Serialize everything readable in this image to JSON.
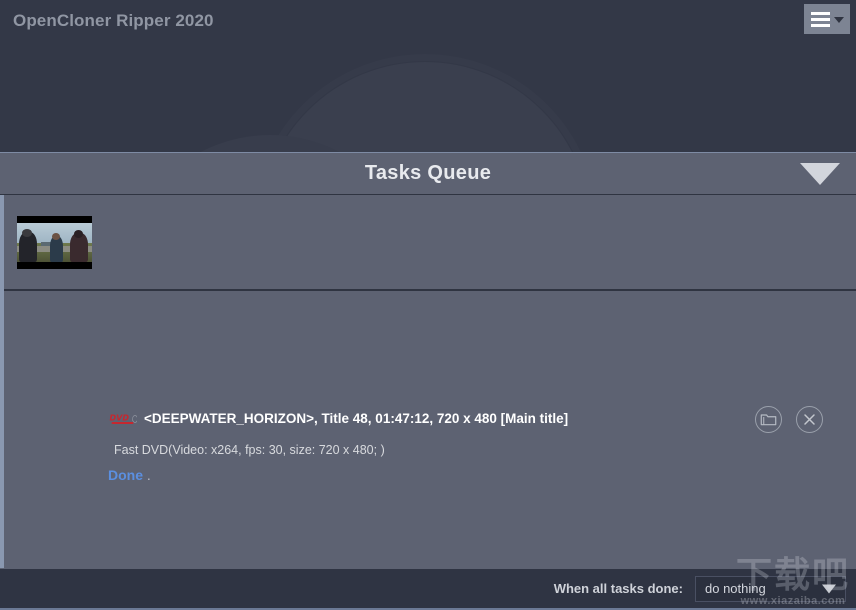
{
  "window": {
    "app_title": "OpenCloner Ripper 2020"
  },
  "header": {
    "menu_button_icon": "hamburger-menu-icon",
    "menu_caret_icon": "chevron-down-icon"
  },
  "queue": {
    "title": "Tasks Queue",
    "collapse_icon": "triangle-down-icon"
  },
  "tasks": [
    {
      "media_icon": "dvd-icon",
      "title": "<DEEPWATER_HORIZON>, Title 48, 01:47:12, 720 x 480 [Main title]",
      "subtitle": "Fast DVD(Video: x264, fps: 30, size: 720 x 480; )",
      "status": "Done",
      "status_suffix": ".",
      "status_color": "#5b8fe0",
      "open_folder_icon": "folder-icon",
      "remove_icon": "close-circle-icon",
      "thumbnail_icon": "video-thumbnail"
    }
  ],
  "footer": {
    "when_done_label": "When all tasks done:",
    "when_done_value": "do nothing",
    "when_done_caret_icon": "triangle-down-icon"
  },
  "watermark": {
    "text_cn": "下载吧",
    "url": "www.xiazaiba.com"
  },
  "colors": {
    "header_bg": "#333847",
    "queue_bar_bg": "#5d6272",
    "list_bg": "#5d6272",
    "bottom_bar_bg": "#2f3443",
    "accent_blue": "#5b8fe0",
    "dvd_red": "#c6272f",
    "left_border": "#8a98b0"
  }
}
